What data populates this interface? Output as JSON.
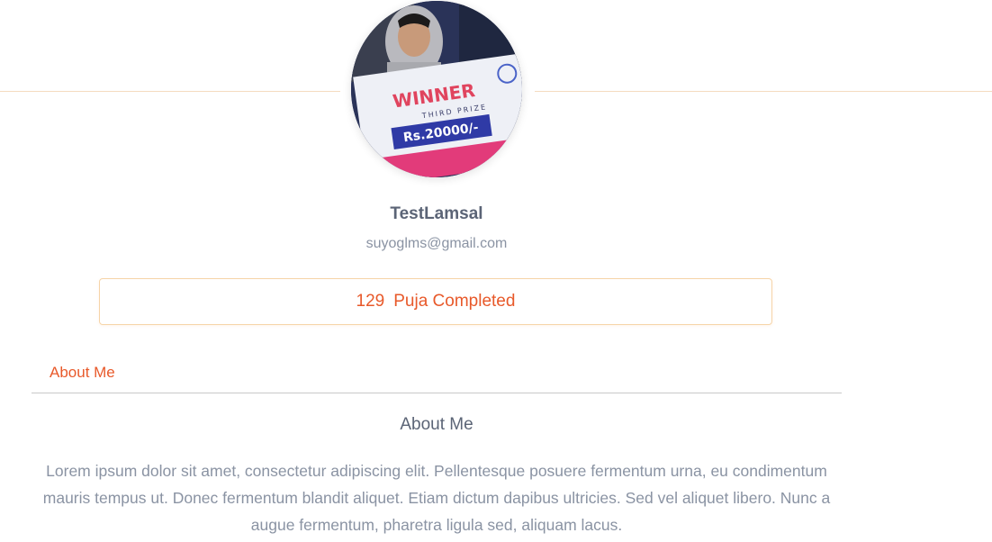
{
  "profile": {
    "name": "TestLamsal",
    "email": "suyoglms@gmail.com",
    "avatar_alt": "profile-photo"
  },
  "stats": {
    "count": "129",
    "label": "Puja Completed"
  },
  "tabs": [
    {
      "label": "About Me",
      "active": true
    }
  ],
  "about": {
    "title": "About Me",
    "body": "Lorem ipsum dolor sit amet, consectetur adipiscing elit. Pellentesque posuere fermentum urna, eu condimentum mauris tempus ut. Donec fermentum blandit aliquet. Etiam dictum dapibus ultricies. Sed vel aliquet libero. Nunc a augue fermentum, pharetra ligula sed, aliquam lacus."
  },
  "colors": {
    "accent": "#e8592a",
    "divider": "#f5dcc0",
    "text_primary": "#5b6476",
    "text_secondary": "#8a93a3"
  },
  "photo_text": {
    "banner": "WINNER",
    "prize": "THIRD PRIZE",
    "amount": "Rs.20000/-"
  }
}
